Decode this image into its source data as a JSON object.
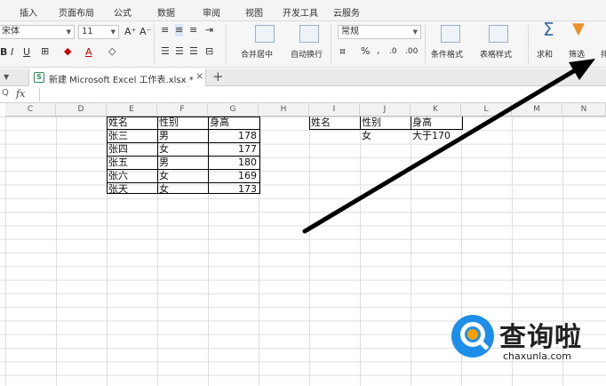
{
  "menu": [
    "插入",
    "页面布局",
    "公式",
    "数据",
    "审阅",
    "视图",
    "开发工具",
    "云服务"
  ],
  "ribbon": {
    "font_name": "宋体",
    "font_size": "11",
    "grow_font": "A⁺",
    "shrink_font": "A⁻",
    "bold": "B",
    "italic": "I",
    "underline": "U",
    "font_color": "A",
    "merge_center_label": "合并居中",
    "wrap_text_label": "自动换行",
    "number_format": "常规",
    "percent": "%",
    "comma": ",",
    "cond_format_label": "条件格式",
    "table_style_label": "表格样式",
    "sum_label": "求和",
    "filter_label": "筛选",
    "sort_label": "排"
  },
  "file_tab": {
    "title": "新建 Microsoft Excel 工作表.xlsx *",
    "close": "×",
    "add": "+"
  },
  "formula_bar": {
    "fx": "fx",
    "zoom_icon": "Q",
    "value": ""
  },
  "columns": [
    "C",
    "D",
    "E",
    "F",
    "G",
    "H",
    "I",
    "J",
    "K",
    "L",
    "M",
    "N"
  ],
  "table1": {
    "headers": [
      "姓名",
      "性别",
      "身高"
    ],
    "rows": [
      [
        "张三",
        "男",
        "178"
      ],
      [
        "张四",
        "女",
        "177"
      ],
      [
        "张五",
        "男",
        "180"
      ],
      [
        "张六",
        "女",
        "169"
      ],
      [
        "张天",
        "女",
        "173"
      ]
    ]
  },
  "criteria": {
    "headers": [
      "姓名",
      "性别",
      "身高"
    ],
    "values": [
      "",
      "女",
      "大于170"
    ]
  },
  "watermark": {
    "title": "查询啦",
    "subtitle": "chaxunla.com"
  },
  "colors": {
    "arrow": "#000000",
    "watermark_blue": "#1e8fe8",
    "watermark_orange": "#f7a000",
    "excel_green": "#2e8b57"
  }
}
